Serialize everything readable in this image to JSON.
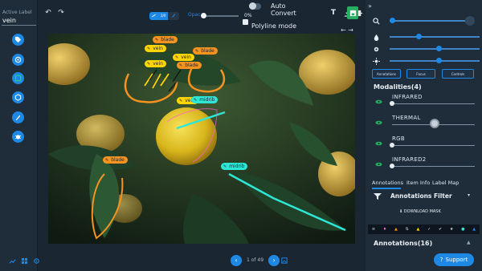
{
  "left_panel": {
    "active_label_caption": "Active Label",
    "active_label_value": "vein"
  },
  "toolbar": {
    "mode_chip_text": "2/0",
    "opacity_label": "Opac",
    "opacity_value": "0%",
    "opacity_level": 0,
    "auto_convert_label": "Auto Convert",
    "polyline_mode_label": "Polyline mode"
  },
  "canvas": {
    "labels": [
      "blade",
      "vein",
      "vein",
      "blade",
      "vein",
      "blade",
      "vein",
      "midrib",
      "blade",
      "midrib"
    ]
  },
  "pager": {
    "text": "1 of 49"
  },
  "right_panel": {
    "filter_chips": [
      "Annotations",
      "Focus",
      "Controls"
    ],
    "modalities_title": "Modalities(4)",
    "modalities": [
      {
        "name": "INFRARED",
        "level": 0.0
      },
      {
        "name": "THERMAL",
        "level": 0.5
      },
      {
        "name": "RGB",
        "level": 0.0
      },
      {
        "name": "INFRARED2",
        "level": 0.0
      }
    ],
    "tabs": [
      "Annotations",
      "Item Info",
      "Label Map"
    ],
    "annotations_filter_label": "Annotations Filter",
    "download_mask_label": "DOWNLOAD MASK",
    "annotations_count": "Annotations(16)",
    "support_label": "Support"
  },
  "colors": {
    "accent": "#1e88e5",
    "vein_color": "#ffd400",
    "blade_color": "#f7931e",
    "midrib_color": "#2ee6d6",
    "save_green": "#27ae60"
  }
}
